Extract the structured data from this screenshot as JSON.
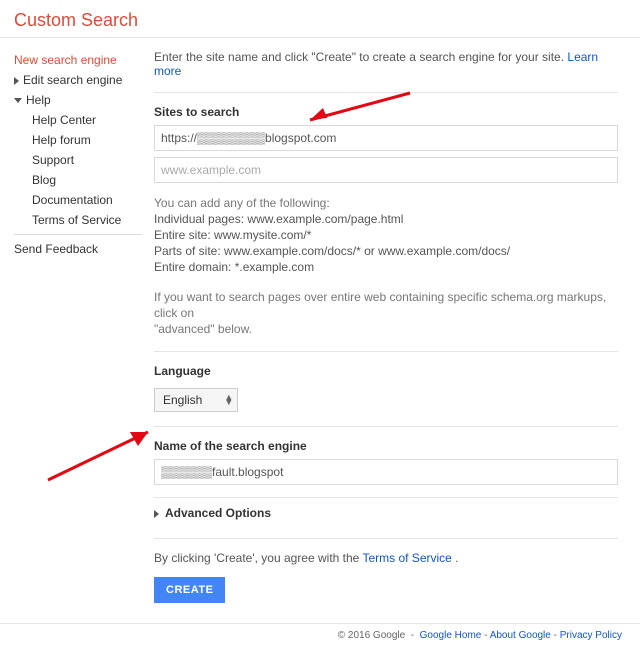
{
  "header": {
    "title": "Custom Search"
  },
  "sidebar": {
    "new_label": "New search engine",
    "edit_label": "Edit search engine",
    "help_label": "Help",
    "help_items": [
      "Help Center",
      "Help forum",
      "Support",
      "Blog",
      "Documentation",
      "Terms of Service"
    ],
    "feedback_label": "Send Feedback"
  },
  "main": {
    "intro": "Enter the site name and click \"Create\" to create a search engine for your site.",
    "learn_more": "Learn more",
    "sites_label": "Sites to search",
    "site_value": "https://▒▒▒▒▒▒▒▒blogspot.com",
    "site_placeholder": "www.example.com",
    "help1": "You can add any of the following:",
    "help_lines": [
      "Individual pages: www.example.com/page.html",
      "Entire site: www.mysite.com/*",
      "Parts of site: www.example.com/docs/* or www.example.com/docs/",
      "Entire domain: *.example.com"
    ],
    "help2a": "If you want to search pages over entire web containing specific schema.org markups, click on",
    "help2b": "\"advanced\" below.",
    "language_label": "Language",
    "language_value": "English",
    "name_label": "Name of the search engine",
    "name_value": "▒▒▒▒▒▒fault.blogspot",
    "advanced_label": "Advanced Options",
    "agree_pre": "By clicking 'Create', you agree with the ",
    "tos": "Terms of Service",
    "create_label": "CREATE"
  },
  "footer": {
    "copyright": "© 2016 Google",
    "links": [
      "Google Home",
      "About Google",
      "Privacy Policy"
    ]
  }
}
